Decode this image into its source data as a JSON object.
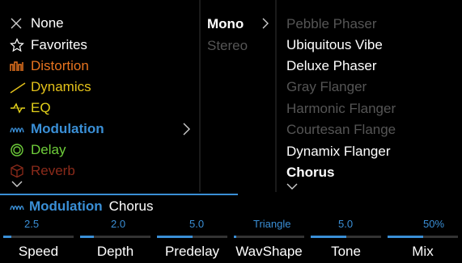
{
  "colors": {
    "accent": "#3a8fd6",
    "distortion": "#e8741f",
    "dynamics": "#e4c21a",
    "eq": "#e4d21a",
    "delay": "#6fcf3a",
    "reverb": "#8a2a1a",
    "dim": "#555555"
  },
  "categories": [
    {
      "label": "None",
      "icon": "close-icon",
      "color": "#ffffff"
    },
    {
      "label": "Favorites",
      "icon": "star-icon",
      "color": "#ffffff"
    },
    {
      "label": "Distortion",
      "icon": "distortion-icon",
      "color": "#e8741f"
    },
    {
      "label": "Dynamics",
      "icon": "dynamics-icon",
      "color": "#e4c21a"
    },
    {
      "label": "EQ",
      "icon": "eq-icon",
      "color": "#e4d21a"
    },
    {
      "label": "Modulation",
      "icon": "modulation-icon",
      "color": "#3a8fd6",
      "selected": true
    },
    {
      "label": "Delay",
      "icon": "delay-icon",
      "color": "#6fcf3a"
    },
    {
      "label": "Reverb",
      "icon": "reverb-icon",
      "color": "#8a2a1a"
    }
  ],
  "channels": [
    {
      "label": "Mono",
      "selected": true
    },
    {
      "label": "Stereo",
      "selected": false
    }
  ],
  "models": [
    {
      "label": "Pebble Phaser",
      "state": "dim"
    },
    {
      "label": "Ubiquitous Vibe",
      "state": "normal"
    },
    {
      "label": "Deluxe Phaser",
      "state": "normal"
    },
    {
      "label": "Gray Flanger",
      "state": "dim"
    },
    {
      "label": "Harmonic Flanger",
      "state": "dim"
    },
    {
      "label": "Courtesan Flange",
      "state": "dim"
    },
    {
      "label": "Dynamix Flanger",
      "state": "normal"
    },
    {
      "label": "Chorus",
      "state": "selected"
    }
  ],
  "bottom": {
    "category": "Modulation",
    "model": "Chorus"
  },
  "params": [
    {
      "name": "Speed",
      "value": "2.5",
      "level": 0.12,
      "align": "left"
    },
    {
      "name": "Depth",
      "value": "2.0",
      "level": 0.2,
      "align": "left"
    },
    {
      "name": "Predelay",
      "value": "5.0",
      "level": 0.5,
      "align": "right"
    },
    {
      "name": "WavShape",
      "value": "Triangle",
      "level": 0.0,
      "align": "center"
    },
    {
      "name": "Tone",
      "value": "5.0",
      "level": 0.5,
      "align": "center"
    },
    {
      "name": "Mix",
      "value": "50%",
      "level": 0.5,
      "align": "right"
    }
  ]
}
